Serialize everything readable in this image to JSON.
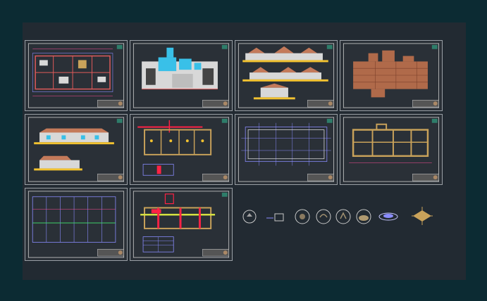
{
  "app": {
    "background": "#0c2b33",
    "canvas_color": "#222a32",
    "sheet_color": "#2a3037",
    "sheet_border": "#9aa0a6"
  },
  "sheets": [
    {
      "id": "floor-plan-furnished",
      "kind": "plan"
    },
    {
      "id": "plan-colored-zones",
      "kind": "plan"
    },
    {
      "id": "elevations",
      "kind": "elevation"
    },
    {
      "id": "roof-plan-timber",
      "kind": "plan"
    },
    {
      "id": "sections",
      "kind": "elevation"
    },
    {
      "id": "electrical-plan",
      "kind": "plan"
    },
    {
      "id": "structural-grid-plan",
      "kind": "plan"
    },
    {
      "id": "foundation-plan",
      "kind": "plan"
    },
    {
      "id": "grid-layout",
      "kind": "plan"
    },
    {
      "id": "plumbing-plan",
      "kind": "plan"
    }
  ],
  "symbols": [
    {
      "name": "circle-tree-symbol"
    },
    {
      "name": "toilet-symbol"
    },
    {
      "name": "tree-symbol-1"
    },
    {
      "name": "tree-symbol-2"
    },
    {
      "name": "tree-symbol-3"
    },
    {
      "name": "tree-symbol-4"
    },
    {
      "name": "shrub-symbol"
    },
    {
      "name": "table-chairs-symbol"
    }
  ]
}
